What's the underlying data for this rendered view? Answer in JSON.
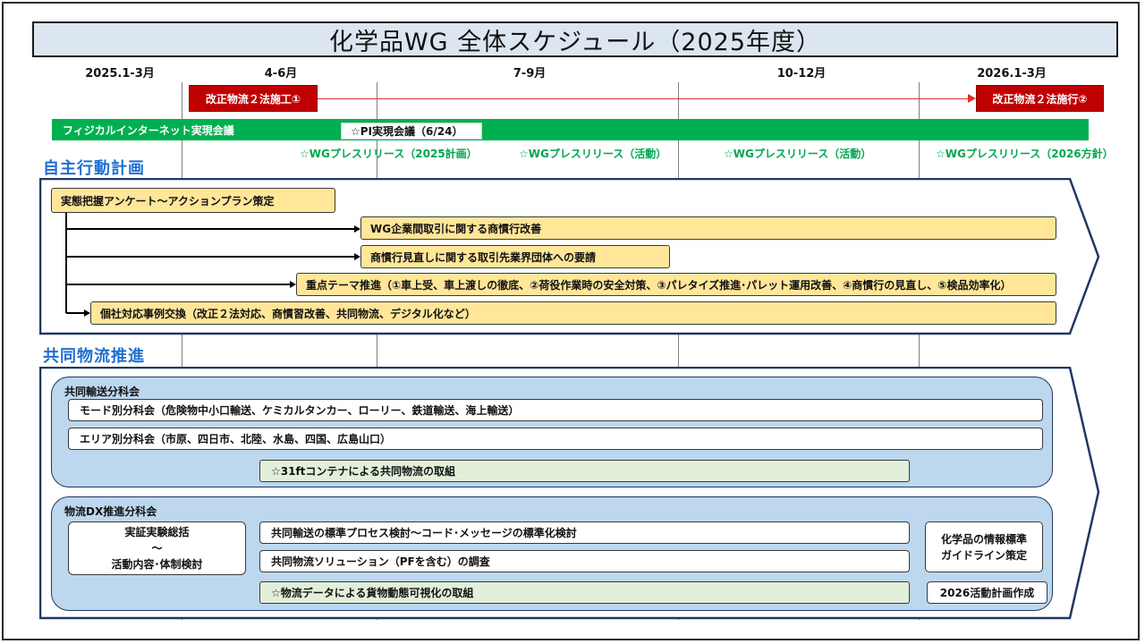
{
  "title": "化学品WG 全体スケジュール（2025年度）",
  "periods": [
    "2025.1-3月",
    "4-6月",
    "7-9月",
    "10-12月",
    "2026.1-3月"
  ],
  "law": {
    "start_label": "改正物流２法施工①",
    "end_label": "改正物流２法施行②"
  },
  "pi": {
    "bar_label": "フィジカルインターネット実現会議",
    "meeting_label": "☆PI実現会議（6/24）"
  },
  "press": [
    "☆WGプレスリリース（2025計画）",
    "☆WGプレスリリース（活動）",
    "☆WGプレスリリース（活動）",
    "☆WGプレスリリース（2026方針）"
  ],
  "section1": {
    "title": "自主行動計画",
    "items": [
      "実態把握アンケート～アクションプラン策定",
      "WG企業間取引に関する商慣行改善",
      "商慣行見直しに関する取引先業界団体への要請",
      "重点テーマ推進（①車上受、車上渡しの徹底、②荷役作業時の安全対策、③パレタイズ推進･パレット運用改善、④商慣行の見直し、⑤検品効率化）",
      "個社対応事例交換（改正２法対応、商慣習改善、共同物流、デジタル化など）"
    ]
  },
  "section2": {
    "title": "共同物流推進",
    "group1": {
      "label": "共同輸送分科会",
      "rows": [
        "モード別分科会（危険物中小口輸送、ケミカルタンカー、ローリー、鉄道輸送、海上輸送）",
        "エリア別分科会（市原、四日市、北陸、水島、四国、広島山口）"
      ],
      "highlight": "☆31ftコンテナによる共同物流の取組"
    },
    "group2": {
      "label": "物流DX推進分科会",
      "left_box": [
        "実証実験総括",
        "～",
        "活動内容･体制検討"
      ],
      "rows": [
        "共同輸送の標準プロセス検討～コード･メッセージの標準化検討",
        "共同物流ソリューション（PFを含む）の調査"
      ],
      "highlight": "☆物流データによる貨物動態可視化の取組",
      "right_box": [
        "化学品の情報標準",
        "ガイドライン策定"
      ],
      "right_small": "2026活動計画作成"
    }
  },
  "colors": {
    "red": "#c00000",
    "green": "#00b050",
    "navy": "#1f3864",
    "section_blue": "#1f6fd0",
    "yellow": "#ffe699",
    "light_blue": "#bdd7ee",
    "light_green": "#e2efda"
  }
}
